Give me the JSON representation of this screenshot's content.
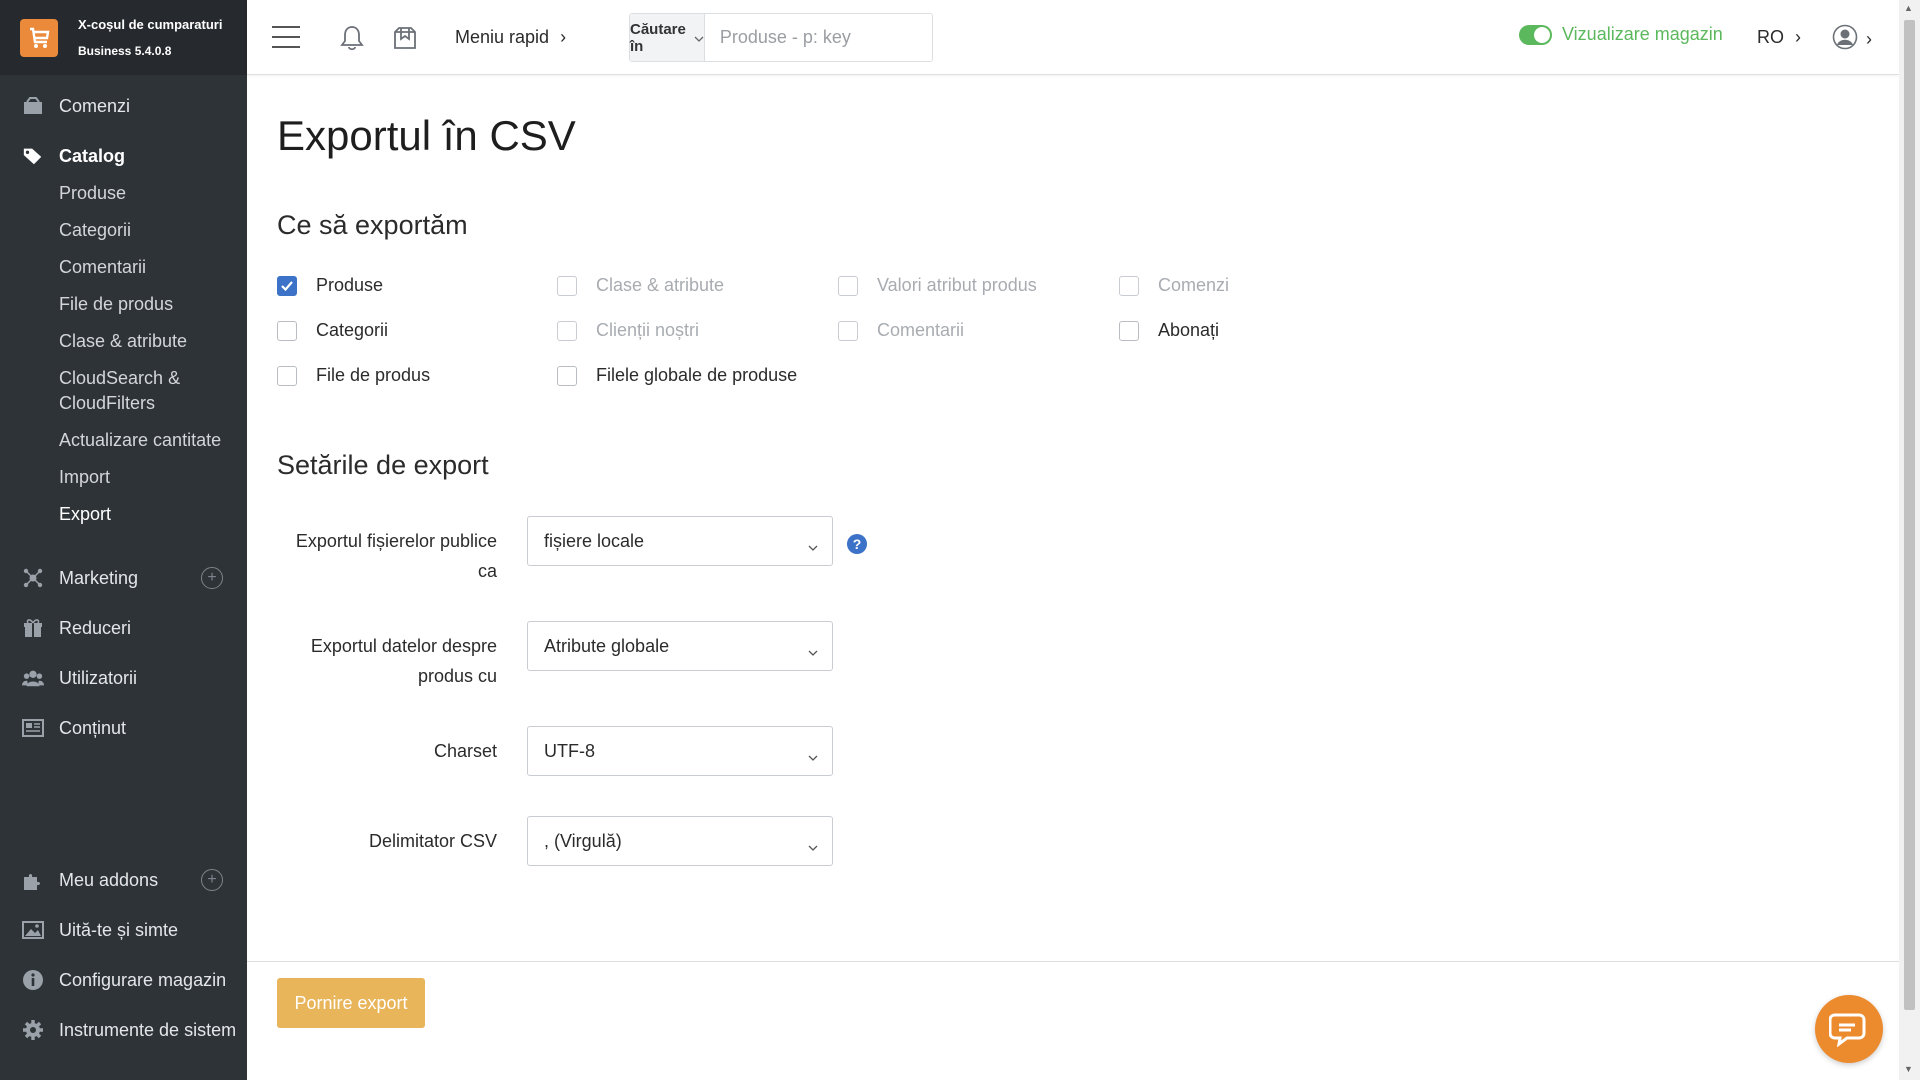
{
  "app": {
    "name": "X-coșul de cumparaturi",
    "version": "Business 5.4.0.8"
  },
  "sidebar": {
    "items": [
      {
        "label": "Comenzi",
        "icon": "orders-icon"
      },
      {
        "label": "Catalog",
        "icon": "tag-icon",
        "active": true
      },
      {
        "label": "Marketing",
        "icon": "marketing-icon"
      },
      {
        "label": "Reduceri",
        "icon": "gift-icon"
      },
      {
        "label": "Utilizatorii",
        "icon": "users-icon"
      },
      {
        "label": "Conținut",
        "icon": "content-icon"
      }
    ],
    "catalog_sub": [
      "Produse",
      "Categorii",
      "Comentarii",
      "File de produs",
      "Clase & atribute",
      "CloudSearch & CloudFilters",
      "Actualizare cantitate",
      "Import",
      "Export"
    ],
    "bottom": [
      {
        "label": "Meu addons",
        "icon": "puzzle-icon"
      },
      {
        "label": "Uită-te și simte",
        "icon": "image-icon"
      },
      {
        "label": "Configurare magazin",
        "icon": "info-icon"
      },
      {
        "label": "Instrumente de sistem",
        "icon": "gear-icon"
      }
    ]
  },
  "topbar": {
    "quick_menu": "Meniu rapid",
    "search_in": "Căutare în",
    "search_placeholder": "Produse - p: key",
    "view_store": "Vizualizare magazin",
    "lang": "RO"
  },
  "page": {
    "title": "Exportul în CSV",
    "what_title": "Ce să exportăm",
    "options": [
      {
        "label": "Produse",
        "checked": true,
        "enabled": true
      },
      {
        "label": "Clase & atribute",
        "checked": false,
        "enabled": false
      },
      {
        "label": "Valori atribut produs",
        "checked": false,
        "enabled": false
      },
      {
        "label": "Comenzi",
        "checked": false,
        "enabled": false
      },
      {
        "label": "Categorii",
        "checked": false,
        "enabled": true
      },
      {
        "label": "Clienții noștri",
        "checked": false,
        "enabled": false
      },
      {
        "label": "Comentarii",
        "checked": false,
        "enabled": false
      },
      {
        "label": "Abonați",
        "checked": false,
        "enabled": true
      },
      {
        "label": "File de produs",
        "checked": false,
        "enabled": true
      },
      {
        "label": "Filele globale de produse",
        "checked": false,
        "enabled": true
      }
    ],
    "settings_title": "Setările de export",
    "settings": [
      {
        "label_l1": "Exportul fișierelor publice",
        "label_l2": "ca",
        "value": "fișiere locale"
      },
      {
        "label_l1": "Exportul datelor despre",
        "label_l2": "produs cu",
        "value": "Atribute globale"
      },
      {
        "label_l1": "Charset",
        "value": "UTF-8"
      },
      {
        "label_l1": "Delimitator CSV",
        "value": ", (Virgulă)"
      }
    ],
    "help": "?",
    "start_button": "Pornire export"
  },
  "colors": {
    "sidebar_bg": "#2e3338",
    "accent_blue": "#3c72c7",
    "button_gold": "#e8b55a",
    "store_green": "#5cb85c",
    "logo_orange": "#ea8a3a"
  }
}
